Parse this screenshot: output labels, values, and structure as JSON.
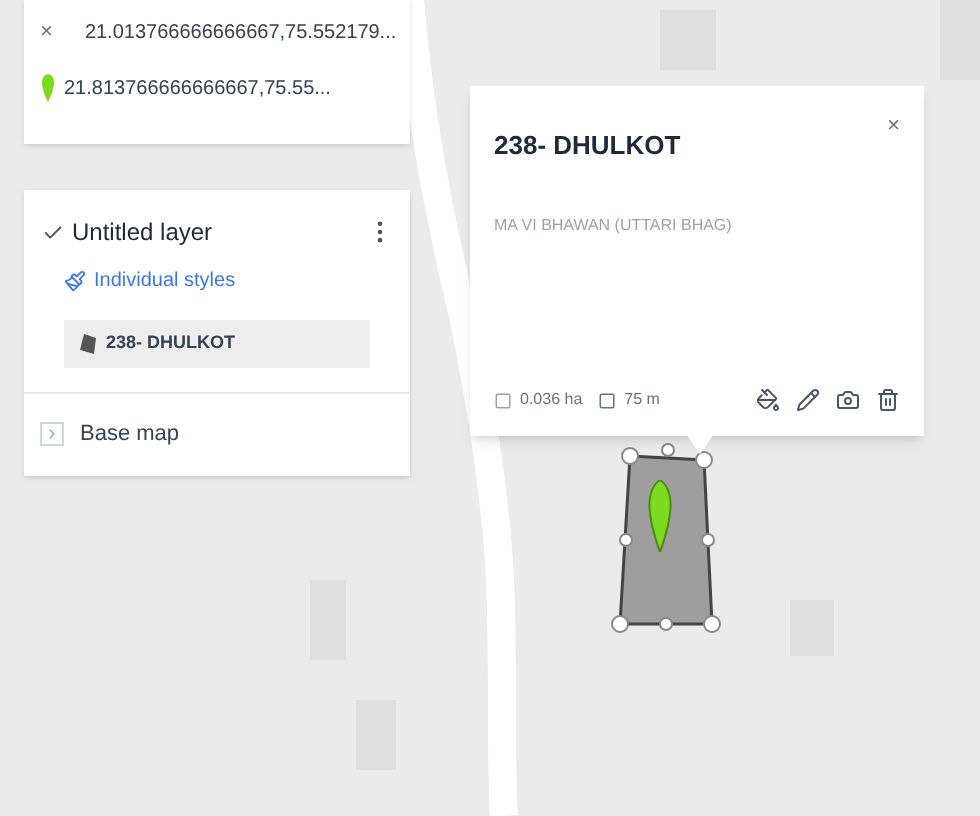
{
  "search": {
    "close": "×",
    "query": "21.013766666666667,75.552179...",
    "result": "21.813766666666667,75.55..."
  },
  "layer": {
    "name": "Untitled layer",
    "checked": true,
    "style": "Individual styles",
    "items": [
      {
        "name": "238- DHULKOT",
        "selected": true
      }
    ]
  },
  "base_map": {
    "label": "Base map",
    "expanded": false
  },
  "popup": {
    "title": "238- DHULKOT",
    "close": "×",
    "description": "MA VI BHAWAN (UTTARI BHAG)",
    "area": "0.036 ha",
    "perimeter": "75 m"
  }
}
